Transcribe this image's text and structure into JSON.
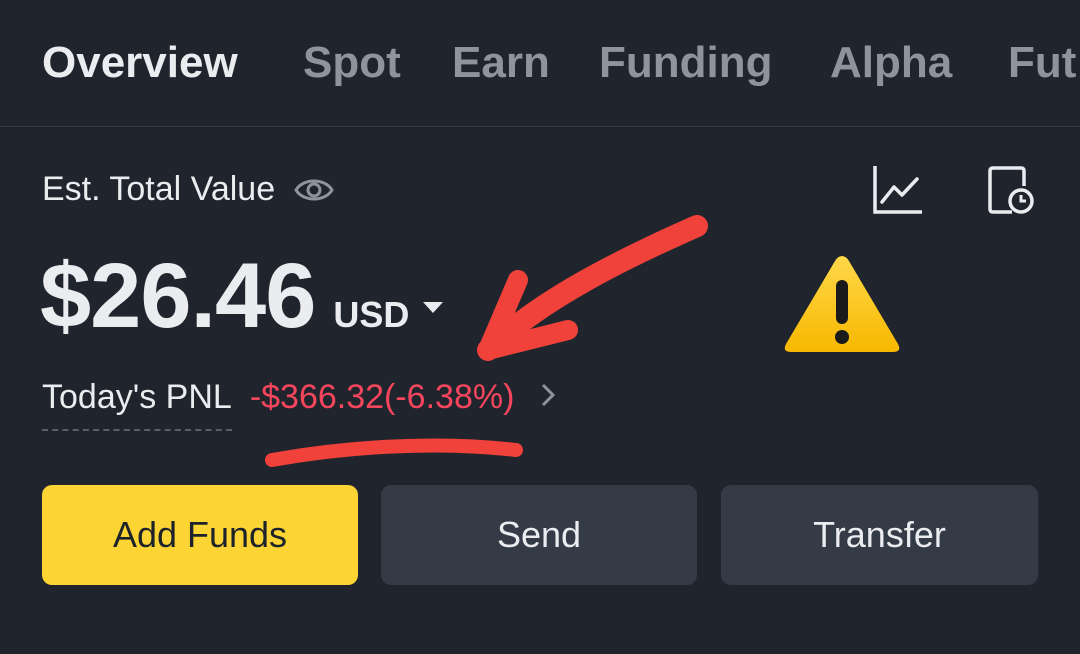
{
  "tabs": [
    {
      "label": "Overview",
      "active": true
    },
    {
      "label": "Spot"
    },
    {
      "label": "Earn"
    },
    {
      "label": "Funding"
    },
    {
      "label": "Alpha"
    },
    {
      "label": "Fut"
    }
  ],
  "balance": {
    "label": "Est. Total Value",
    "value": "$26.46",
    "currency": "USD"
  },
  "pnl": {
    "label": "Today's PNL",
    "value": "-$366.32(-6.38%)"
  },
  "actions": {
    "add_funds": "Add Funds",
    "send": "Send",
    "transfer": "Transfer"
  },
  "icons": {
    "visibility": "eye-icon",
    "chart": "line-chart-icon",
    "history": "history-icon",
    "warning": "warning-icon",
    "dropdown": "caret-down-icon",
    "details": "chevron-right-icon"
  },
  "colors": {
    "background": "#1f242d",
    "primary": "#fcd535",
    "negative": "#f6465d",
    "annotation": "#f0423a"
  }
}
